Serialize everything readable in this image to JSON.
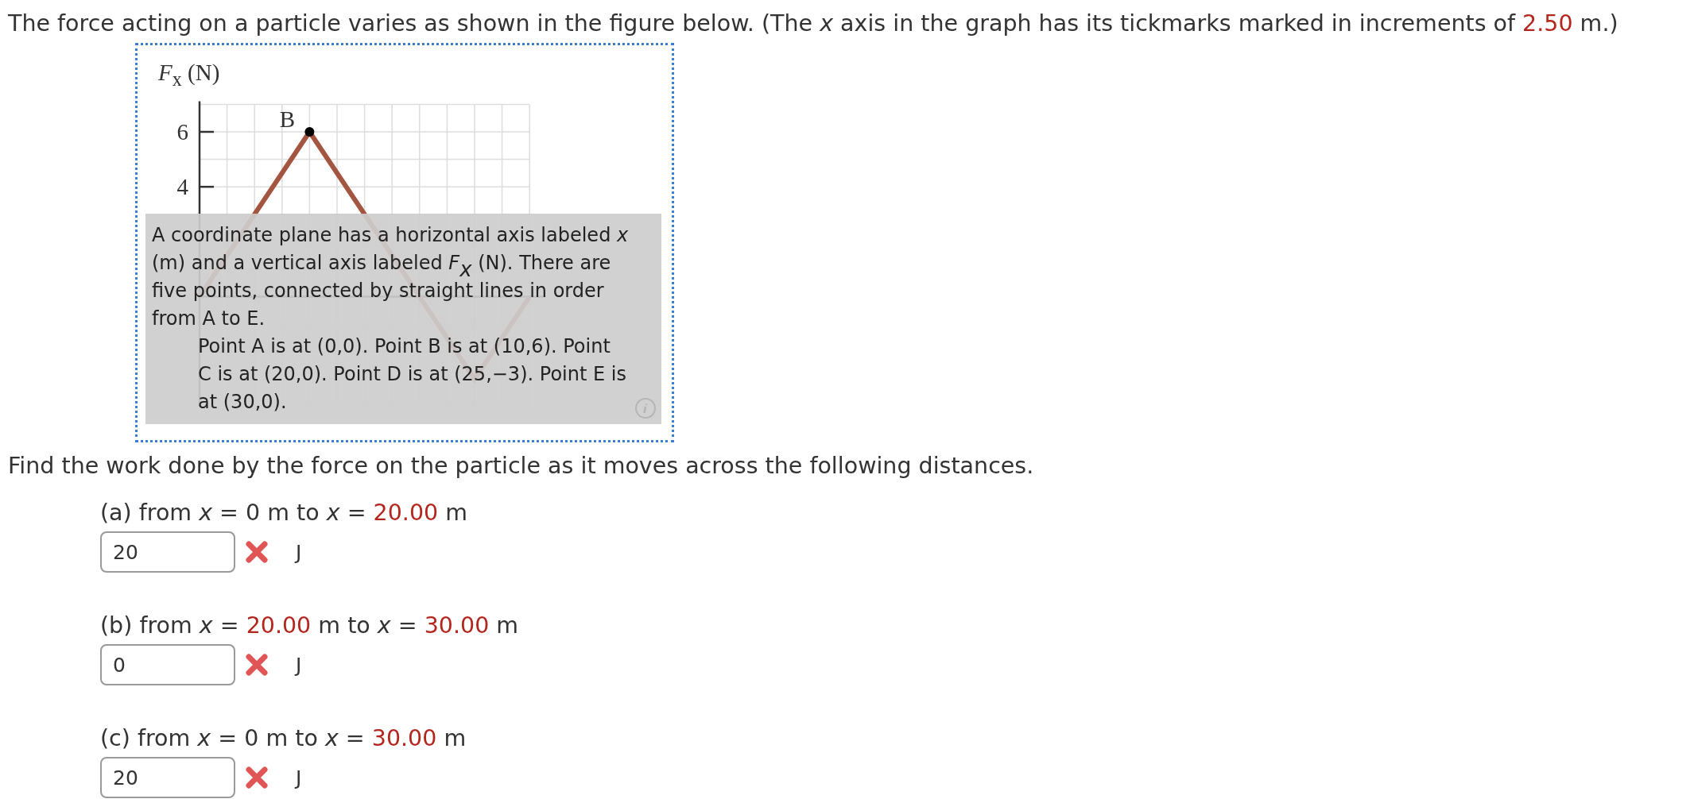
{
  "intro": {
    "segments": [
      {
        "text": "The force acting on a particle varies as shown in the figure below. (The *x* axis in the graph has its tickmarks marked in increments of ",
        "given": false
      },
      {
        "text": "2.50",
        "given": true
      },
      {
        "text": " m.)",
        "given": false
      }
    ]
  },
  "figure": {
    "y_axis_label": "*F*$_{x}$ (N)",
    "tick_labels": [
      "6",
      "4"
    ],
    "point_label": "B",
    "description": {
      "paragraphs": [
        {
          "text": "A coordinate plane has a horizontal axis labeled *x* (m) and a vertical axis labeled *F*$_{x}$ (N). There are five points, connected by straight lines in order from A to E.",
          "indented": false
        },
        {
          "text": "Point A is at (0,0). Point B is at (10,6). Point C is at (20,0). Point D is at (25,−3). Point E is at (30,0).",
          "indented": true
        }
      ]
    }
  },
  "instruction": "Find the work done by the force on the particle as it moves across the following distances.",
  "parts": [
    {
      "segments": [
        {
          "text": "(a) from *x* = 0 m to *x* = ",
          "given": false
        },
        {
          "text": "20.00",
          "given": true
        },
        {
          "text": " m",
          "given": false
        }
      ],
      "answer": "20",
      "correct": false,
      "unit": "J"
    },
    {
      "segments": [
        {
          "text": "(b) from *x* = ",
          "given": false
        },
        {
          "text": "20.00",
          "given": true
        },
        {
          "text": " m to *x* = ",
          "given": false
        },
        {
          "text": "30.00",
          "given": true
        },
        {
          "text": " m",
          "given": false
        }
      ],
      "answer": "0",
      "correct": false,
      "unit": "J"
    },
    {
      "segments": [
        {
          "text": "(c) from *x* = 0 m to *x* = ",
          "given": false
        },
        {
          "text": "30.00",
          "given": true
        },
        {
          "text": " m",
          "given": false
        }
      ],
      "answer": "20",
      "correct": false,
      "unit": "J"
    }
  ]
}
